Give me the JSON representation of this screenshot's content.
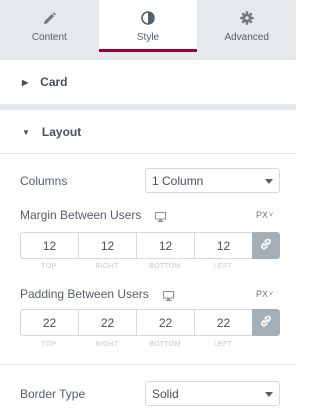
{
  "tabs": [
    {
      "label": "Content",
      "icon": "pencil-icon"
    },
    {
      "label": "Style",
      "icon": "half-circle-icon"
    },
    {
      "label": "Advanced",
      "icon": "gear-icon"
    }
  ],
  "sections": {
    "card": "Card",
    "layout": "Layout"
  },
  "columns": {
    "label": "Columns",
    "value": "1 Column"
  },
  "margin": {
    "label": "Margin Between Users",
    "unit": "PX",
    "values": {
      "top": "12",
      "right": "12",
      "bottom": "12",
      "left": "12"
    }
  },
  "padding": {
    "label": "Padding Between Users",
    "unit": "PX",
    "values": {
      "top": "22",
      "right": "22",
      "bottom": "22",
      "left": "22"
    }
  },
  "dimension_labels": {
    "top": "TOP",
    "right": "RIGHT",
    "bottom": "BOTTOM",
    "left": "LEFT"
  },
  "border_type": {
    "label": "Border Type",
    "value": "Solid"
  },
  "colors": {
    "accent": "#93003c",
    "link_button": "#a4afb7",
    "panel_gray": "#e6e9ec"
  }
}
